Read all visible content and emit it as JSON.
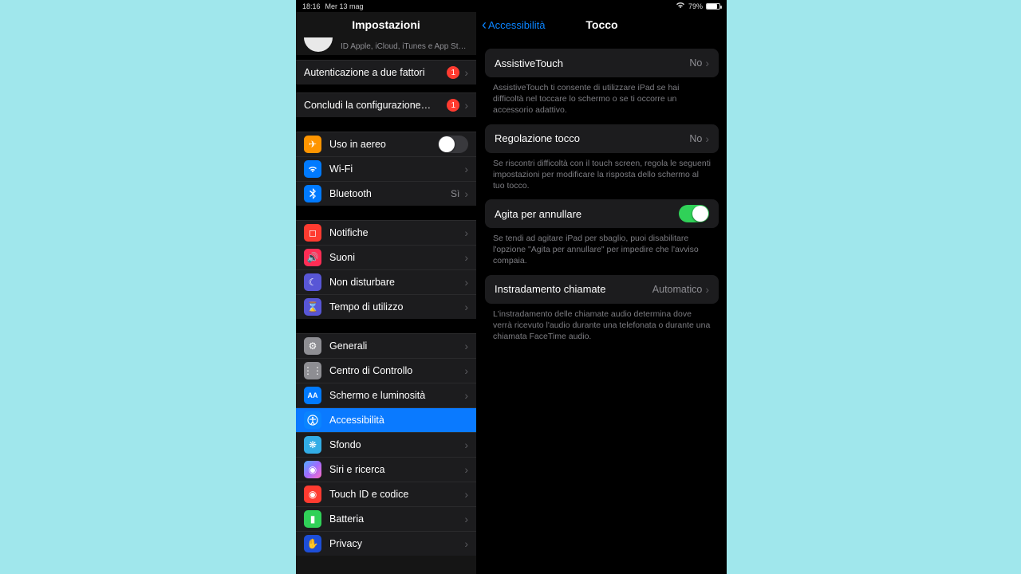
{
  "status": {
    "time": "18:16",
    "date": "Mer 13 mag",
    "battery": "79%"
  },
  "left_title": "Impostazioni",
  "account_sub": "ID Apple, iCloud, iTunes e App St…",
  "rows": {
    "twofa": {
      "label": "Autenticazione a due fattori",
      "badge": "1"
    },
    "finish": {
      "label": "Concludi la configurazione…",
      "badge": "1"
    },
    "airplane": {
      "label": "Uso in aereo"
    },
    "wifi": {
      "label": "Wi-Fi",
      "value": ""
    },
    "bt": {
      "label": "Bluetooth",
      "value": "Sì"
    },
    "notif": {
      "label": "Notifiche"
    },
    "sounds": {
      "label": "Suoni"
    },
    "dnd": {
      "label": "Non disturbare"
    },
    "screentime": {
      "label": "Tempo di utilizzo"
    },
    "general": {
      "label": "Generali"
    },
    "control": {
      "label": "Centro di Controllo"
    },
    "display": {
      "label": "Schermo e luminosità"
    },
    "access": {
      "label": "Accessibilità"
    },
    "wall": {
      "label": "Sfondo"
    },
    "siri": {
      "label": "Siri e ricerca"
    },
    "touchid": {
      "label": "Touch ID e codice"
    },
    "battery": {
      "label": "Batteria"
    },
    "privacy": {
      "label": "Privacy"
    }
  },
  "detail": {
    "back": "Accessibilità",
    "title": "Tocco",
    "assistive": {
      "label": "AssistiveTouch",
      "value": "No",
      "footer": "AssistiveTouch ti consente di utilizzare iPad se hai difficoltà nel toccare lo schermo o se ti occorre un accessorio adattivo."
    },
    "touchacc": {
      "label": "Regolazione tocco",
      "value": "No",
      "footer": "Se riscontri difficoltà con il touch screen, regola le seguenti impostazioni per modificare la risposta dello schermo al tuo tocco."
    },
    "shake": {
      "label": "Agita per annullare",
      "footer": "Se tendi ad agitare iPad per sbaglio, puoi disabilitare l'opzione \"Agita per annullare\" per impedire che l'avviso compaia."
    },
    "routing": {
      "label": "Instradamento chiamate",
      "value": "Automatico",
      "footer": "L'instradamento delle chiamate audio determina dove verrà ricevuto l'audio durante una telefonata o durante una chiamata FaceTime audio."
    }
  }
}
